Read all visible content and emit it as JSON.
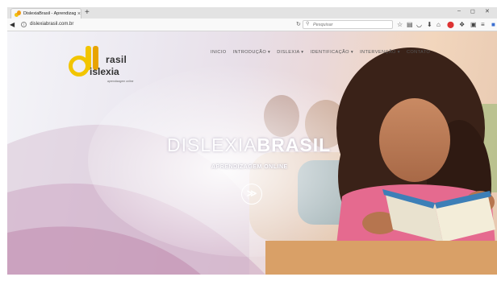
{
  "browser": {
    "tab": {
      "title": "DislexiaBrasil - Aprendizag",
      "close": "×"
    },
    "new_tab": "+",
    "window_controls": {
      "minimize": "–",
      "maximize": "◻",
      "close": "✕"
    },
    "url": "dislexiabrasil.com.br",
    "search": {
      "placeholder": "Pesquisar"
    }
  },
  "site": {
    "logo": {
      "line1": "rasil",
      "line2": "islexia",
      "tagline": "aprendizagem online"
    },
    "menu": [
      {
        "label": "INICIO"
      },
      {
        "label": "INTRODUÇÃO ▾"
      },
      {
        "label": "DISLEXIA ▾"
      },
      {
        "label": "IDENTIFICAÇÃO ▾"
      },
      {
        "label": "INTERVENÇÃO ▾"
      },
      {
        "label": "CONTATO"
      }
    ],
    "hero": {
      "title_light": "DISLEXIA",
      "title_bold": "BRASIL",
      "subtitle": "APRENDIZAGEM ONLINE",
      "scroll_icon": "≫"
    }
  },
  "colors": {
    "logo_yellow": "#f2c500",
    "logo_orange": "#e8a400"
  }
}
